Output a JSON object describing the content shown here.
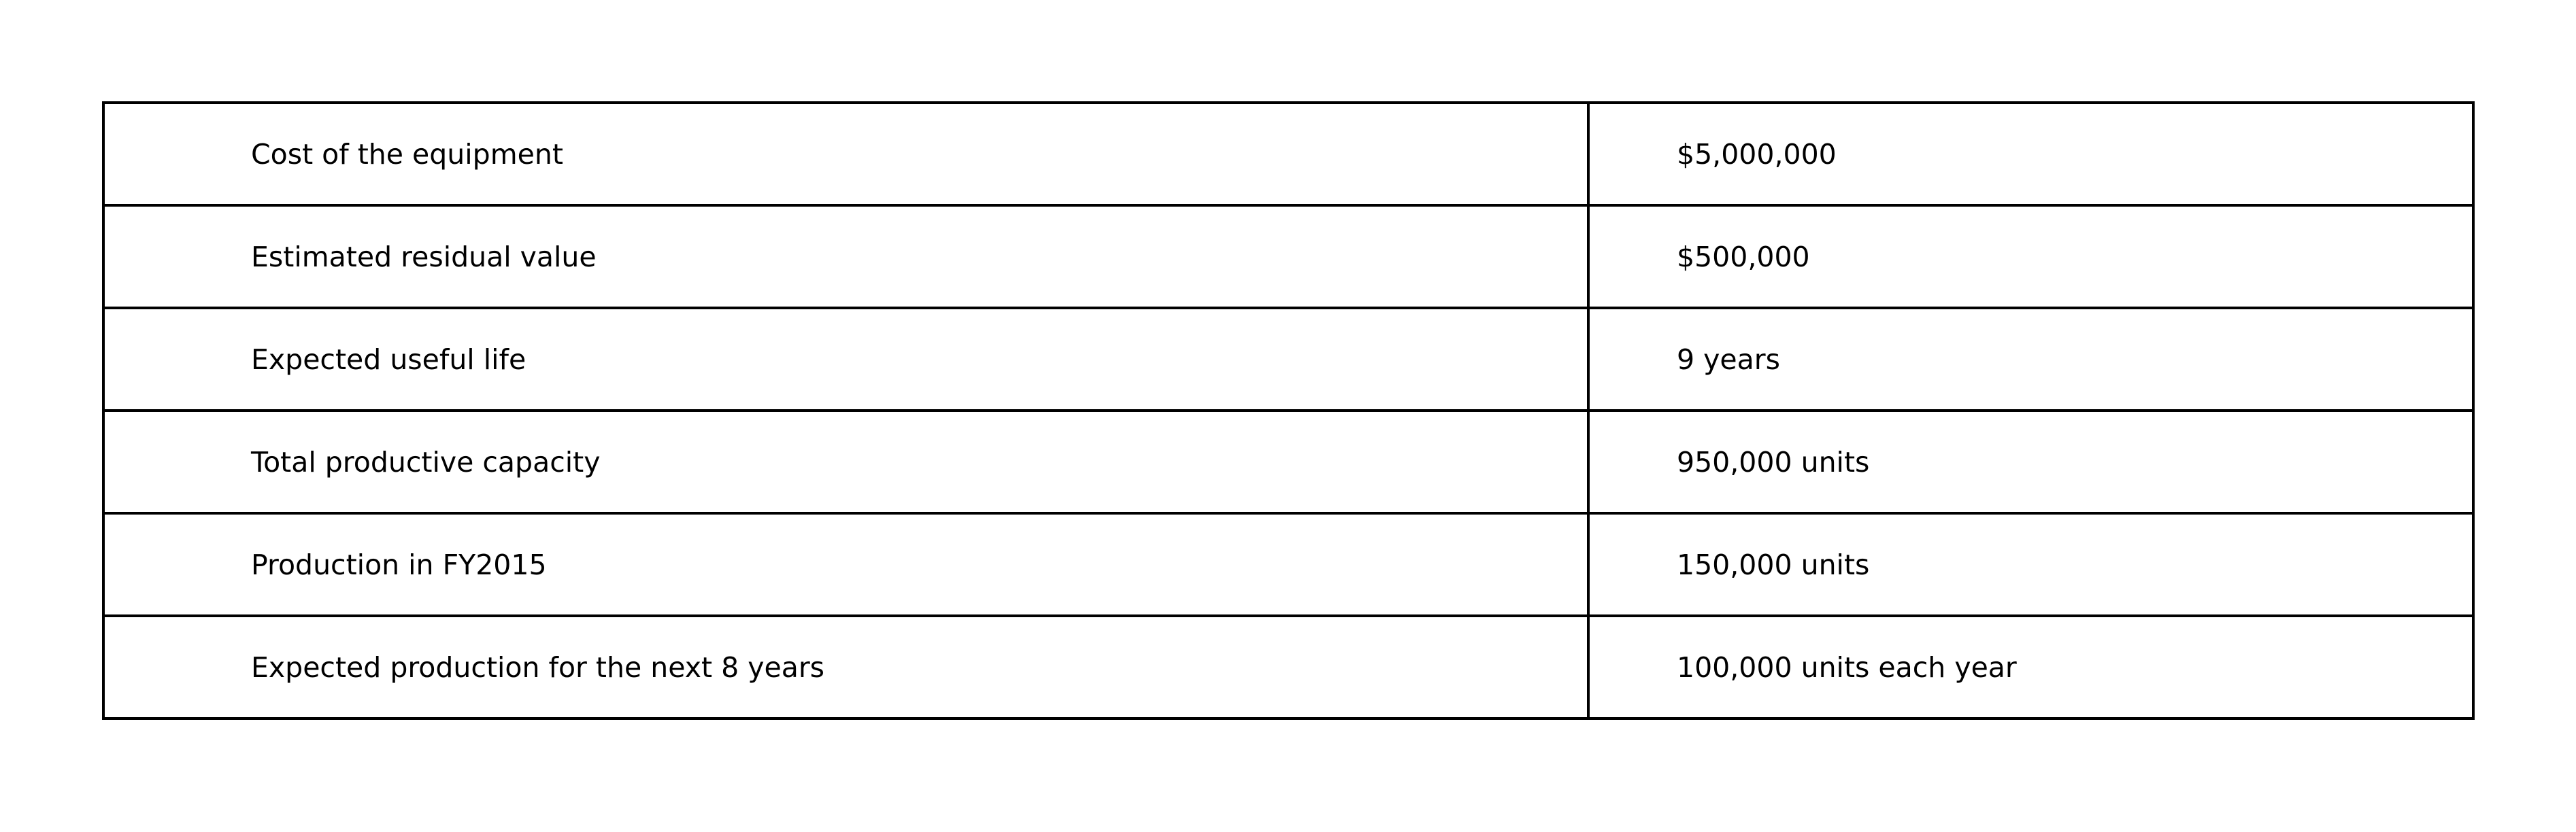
{
  "table": {
    "rows": [
      {
        "label": "Cost of the equipment",
        "value": "$5,000,000"
      },
      {
        "label": "Estimated residual value",
        "value": "$500,000"
      },
      {
        "label": "Expected useful life",
        "value": "9 years"
      },
      {
        "label": "Total productive capacity",
        "value": "950,000 units"
      },
      {
        "label": "Production in FY2015",
        "value": "150,000 units"
      },
      {
        "label": "Expected production for the next 8 years",
        "value": "100,000 units each year"
      }
    ]
  }
}
